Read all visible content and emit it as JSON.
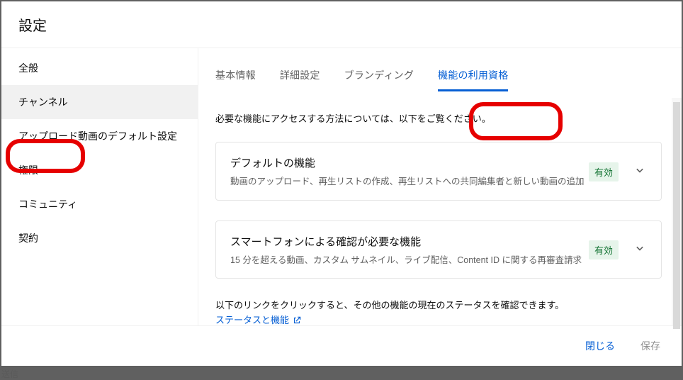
{
  "header": {
    "title": "設定"
  },
  "sidebar": {
    "items": [
      {
        "label": "全般"
      },
      {
        "label": "チャンネル"
      },
      {
        "label": "アップロード動画のデフォルト設定"
      },
      {
        "label": "権限"
      },
      {
        "label": "コミュニティ"
      },
      {
        "label": "契約"
      }
    ],
    "activeIndex": 1
  },
  "tabs": {
    "items": [
      {
        "label": "基本情報"
      },
      {
        "label": "詳細設定"
      },
      {
        "label": "ブランディング"
      },
      {
        "label": "機能の利用資格"
      }
    ],
    "activeIndex": 3
  },
  "content": {
    "description": "必要な機能にアクセスする方法については、以下をご覧ください。",
    "cards": [
      {
        "title": "デフォルトの機能",
        "subtitle": "動画のアップロード、再生リストの作成、再生リストへの共同編集者と新しい動画の追加",
        "badge": "有効"
      },
      {
        "title": "スマートフォンによる確認が必要な機能",
        "subtitle": "15 分を超える動画、カスタム サムネイル、ライブ配信、Content ID に関する再審査請求",
        "badge": "有効"
      }
    ],
    "note": "以下のリンクをクリックすると、その他の機能の現在のステータスを確認できます。",
    "link": "ステータスと機能"
  },
  "footer": {
    "close": "閉じる",
    "save": "保存"
  },
  "bg": {
    "text": "送信"
  }
}
